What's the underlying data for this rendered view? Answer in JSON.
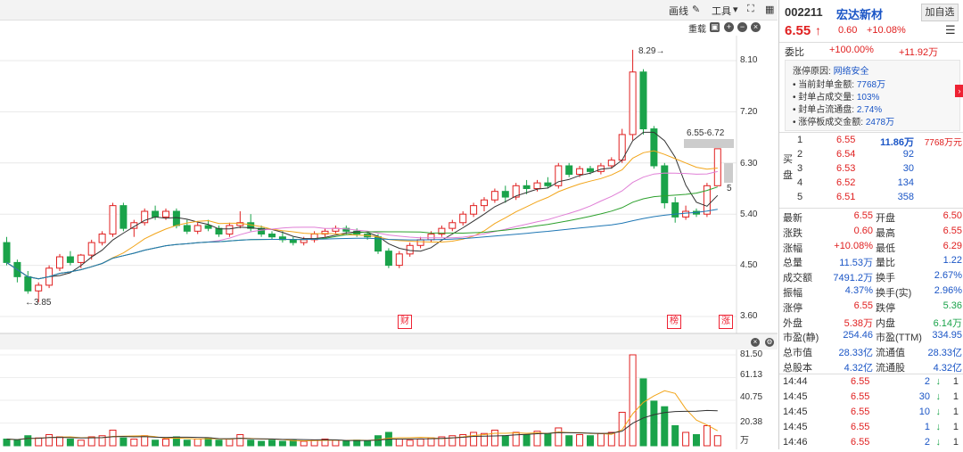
{
  "toolbar": {
    "draw_label": "画线",
    "tools_label": "工具",
    "reset_label": "重载"
  },
  "chart": {
    "y_ticks": [
      "8.10",
      "7.20",
      "6.30",
      "5.40",
      "4.50",
      "3.60"
    ],
    "vol_ticks": [
      "81.50",
      "61.13",
      "40.75",
      "20.38",
      "万"
    ],
    "high_annot": "8.29→",
    "low_annot": "←3.85",
    "range_annot": "6.55-6.72",
    "five_annot": "5",
    "markers": [
      "财",
      "榜",
      "涨"
    ],
    "candles": [
      {
        "o": 4.9,
        "h": 5.0,
        "l": 4.5,
        "c": 4.55
      },
      {
        "o": 4.55,
        "h": 4.6,
        "l": 4.2,
        "c": 4.3
      },
      {
        "o": 4.3,
        "h": 4.4,
        "l": 4.0,
        "c": 4.05
      },
      {
        "o": 4.05,
        "h": 4.2,
        "l": 3.85,
        "c": 4.15
      },
      {
        "o": 4.15,
        "h": 4.5,
        "l": 4.1,
        "c": 4.45
      },
      {
        "o": 4.45,
        "h": 4.7,
        "l": 4.4,
        "c": 4.65
      },
      {
        "o": 4.65,
        "h": 4.75,
        "l": 4.5,
        "c": 4.55
      },
      {
        "o": 4.55,
        "h": 4.7,
        "l": 4.45,
        "c": 4.68
      },
      {
        "o": 4.68,
        "h": 4.95,
        "l": 4.6,
        "c": 4.9
      },
      {
        "o": 4.9,
        "h": 5.1,
        "l": 4.85,
        "c": 5.05
      },
      {
        "o": 5.05,
        "h": 5.6,
        "l": 5.0,
        "c": 5.55
      },
      {
        "o": 5.55,
        "h": 5.6,
        "l": 5.1,
        "c": 5.15
      },
      {
        "o": 5.15,
        "h": 5.3,
        "l": 5.0,
        "c": 5.25
      },
      {
        "o": 5.25,
        "h": 5.5,
        "l": 5.2,
        "c": 5.45
      },
      {
        "o": 5.45,
        "h": 5.55,
        "l": 5.3,
        "c": 5.35
      },
      {
        "o": 5.35,
        "h": 5.5,
        "l": 5.3,
        "c": 5.45
      },
      {
        "o": 5.45,
        "h": 5.5,
        "l": 5.15,
        "c": 5.2
      },
      {
        "o": 5.2,
        "h": 5.3,
        "l": 5.05,
        "c": 5.1
      },
      {
        "o": 5.1,
        "h": 5.25,
        "l": 5.05,
        "c": 5.2
      },
      {
        "o": 5.2,
        "h": 5.3,
        "l": 5.1,
        "c": 5.15
      },
      {
        "o": 5.15,
        "h": 5.2,
        "l": 5.0,
        "c": 5.05
      },
      {
        "o": 5.05,
        "h": 5.25,
        "l": 5.0,
        "c": 5.2
      },
      {
        "o": 5.2,
        "h": 5.45,
        "l": 5.15,
        "c": 5.25
      },
      {
        "o": 5.25,
        "h": 5.4,
        "l": 5.1,
        "c": 5.15
      },
      {
        "o": 5.15,
        "h": 5.2,
        "l": 5.0,
        "c": 5.05
      },
      {
        "o": 5.05,
        "h": 5.1,
        "l": 4.95,
        "c": 5.0
      },
      {
        "o": 5.0,
        "h": 5.1,
        "l": 4.9,
        "c": 4.95
      },
      {
        "o": 4.95,
        "h": 5.0,
        "l": 4.85,
        "c": 4.9
      },
      {
        "o": 4.9,
        "h": 5.0,
        "l": 4.85,
        "c": 4.95
      },
      {
        "o": 4.95,
        "h": 5.1,
        "l": 4.9,
        "c": 5.05
      },
      {
        "o": 5.05,
        "h": 5.15,
        "l": 5.0,
        "c": 5.1
      },
      {
        "o": 5.1,
        "h": 5.2,
        "l": 5.05,
        "c": 5.15
      },
      {
        "o": 5.15,
        "h": 5.2,
        "l": 5.05,
        "c": 5.1
      },
      {
        "o": 5.1,
        "h": 5.15,
        "l": 5.0,
        "c": 5.05
      },
      {
        "o": 5.05,
        "h": 5.1,
        "l": 4.95,
        "c": 5.0
      },
      {
        "o": 5.0,
        "h": 5.05,
        "l": 4.7,
        "c": 4.75
      },
      {
        "o": 4.75,
        "h": 4.8,
        "l": 4.45,
        "c": 4.5
      },
      {
        "o": 4.5,
        "h": 4.75,
        "l": 4.45,
        "c": 4.7
      },
      {
        "o": 4.7,
        "h": 4.9,
        "l": 4.65,
        "c": 4.85
      },
      {
        "o": 4.85,
        "h": 5.0,
        "l": 4.8,
        "c": 4.95
      },
      {
        "o": 4.95,
        "h": 5.1,
        "l": 4.9,
        "c": 5.05
      },
      {
        "o": 5.05,
        "h": 5.2,
        "l": 5.0,
        "c": 5.15
      },
      {
        "o": 5.15,
        "h": 5.3,
        "l": 5.1,
        "c": 5.25
      },
      {
        "o": 5.25,
        "h": 5.45,
        "l": 5.2,
        "c": 5.4
      },
      {
        "o": 5.4,
        "h": 5.6,
        "l": 5.35,
        "c": 5.55
      },
      {
        "o": 5.55,
        "h": 5.7,
        "l": 5.45,
        "c": 5.65
      },
      {
        "o": 5.65,
        "h": 5.85,
        "l": 5.6,
        "c": 5.8
      },
      {
        "o": 5.8,
        "h": 5.9,
        "l": 5.6,
        "c": 5.7
      },
      {
        "o": 5.7,
        "h": 5.95,
        "l": 5.65,
        "c": 5.9
      },
      {
        "o": 5.9,
        "h": 6.0,
        "l": 5.75,
        "c": 5.85
      },
      {
        "o": 5.85,
        "h": 6.0,
        "l": 5.8,
        "c": 5.95
      },
      {
        "o": 5.95,
        "h": 6.05,
        "l": 5.85,
        "c": 5.9
      },
      {
        "o": 5.9,
        "h": 6.3,
        "l": 5.85,
        "c": 6.25
      },
      {
        "o": 6.25,
        "h": 6.3,
        "l": 6.05,
        "c": 6.1
      },
      {
        "o": 6.1,
        "h": 6.25,
        "l": 6.05,
        "c": 6.2
      },
      {
        "o": 6.2,
        "h": 6.25,
        "l": 6.1,
        "c": 6.15
      },
      {
        "o": 6.15,
        "h": 6.3,
        "l": 6.1,
        "c": 6.25
      },
      {
        "o": 6.25,
        "h": 6.4,
        "l": 6.2,
        "c": 6.35
      },
      {
        "o": 6.35,
        "h": 6.9,
        "l": 6.3,
        "c": 6.8
      },
      {
        "o": 6.8,
        "h": 8.29,
        "l": 6.7,
        "c": 7.9
      },
      {
        "o": 7.9,
        "h": 7.95,
        "l": 6.8,
        "c": 6.9
      },
      {
        "o": 6.9,
        "h": 6.95,
        "l": 6.2,
        "c": 6.25
      },
      {
        "o": 6.25,
        "h": 6.3,
        "l": 5.5,
        "c": 5.6
      },
      {
        "o": 5.6,
        "h": 5.7,
        "l": 5.25,
        "c": 5.35
      },
      {
        "o": 5.35,
        "h": 5.55,
        "l": 5.3,
        "c": 5.45
      },
      {
        "o": 5.45,
        "h": 5.5,
        "l": 5.35,
        "c": 5.4
      },
      {
        "o": 5.4,
        "h": 5.95,
        "l": 5.35,
        "c": 5.9
      },
      {
        "o": 5.9,
        "h": 6.55,
        "l": 5.9,
        "c": 6.55
      }
    ],
    "volumes": [
      6,
      5,
      9,
      7,
      10,
      8,
      6,
      5,
      8,
      9,
      14,
      7,
      6,
      9,
      5,
      6,
      8,
      5,
      6,
      7,
      5,
      6,
      10,
      5,
      4,
      5,
      4,
      5,
      4,
      5,
      6,
      5,
      4,
      5,
      4,
      9,
      12,
      6,
      5,
      6,
      7,
      8,
      9,
      10,
      12,
      11,
      14,
      9,
      12,
      10,
      13,
      11,
      16,
      9,
      10,
      9,
      11,
      12,
      30,
      81.5,
      60,
      40,
      35,
      18,
      12,
      10,
      18,
      9
    ]
  },
  "quote": {
    "code": "002211",
    "name": "宏达新材",
    "add_label": "加自选",
    "price": "6.55",
    "change": "0.60",
    "change_pct": "+10.08%",
    "wb_label": "委比",
    "wb_value": "+100.00%",
    "wb_amount": "+11.92万",
    "limit": {
      "reason_label": "涨停原因:",
      "reason": "网络安全",
      "seal_amt_label": "当前封单金额:",
      "seal_amt": "7768万",
      "seal_vol_label": "封单占成交量:",
      "seal_vol": "103%",
      "seal_float_label": "封单占流通盘:",
      "seal_float": "2.74%",
      "limit_amt_label": "涨停板成交金额:",
      "limit_amt": "2478万"
    },
    "buy_label": "买盘",
    "bids": [
      {
        "lvl": "1",
        "price": "6.55",
        "vol": "11.86万",
        "amt": "7768万元"
      },
      {
        "lvl": "2",
        "price": "6.54",
        "vol": "92",
        "amt": ""
      },
      {
        "lvl": "3",
        "price": "6.53",
        "vol": "30",
        "amt": ""
      },
      {
        "lvl": "4",
        "price": "6.52",
        "vol": "134",
        "amt": ""
      },
      {
        "lvl": "5",
        "price": "6.51",
        "vol": "358",
        "amt": ""
      }
    ],
    "stats": [
      {
        "l1": "最新",
        "v1": "6.55",
        "l2": "开盘",
        "v2": "6.50"
      },
      {
        "l1": "涨跌",
        "v1": "0.60",
        "l2": "最高",
        "v2": "6.55"
      },
      {
        "l1": "涨幅",
        "v1": "+10.08%",
        "l2": "最低",
        "v2": "6.29"
      },
      {
        "l1": "总量",
        "v1": "11.53万",
        "l2": "量比",
        "v2": "1.22"
      },
      {
        "l1": "成交额",
        "v1": "7491.2万",
        "l2": "换手",
        "v2": "2.67%"
      },
      {
        "l1": "振幅",
        "v1": "4.37%",
        "l2": "换手(实)",
        "v2": "2.96%"
      },
      {
        "l1": "涨停",
        "v1": "6.55",
        "l2": "跌停",
        "v2": "5.36"
      },
      {
        "l1": "外盘",
        "v1": "5.38万",
        "l2": "内盘",
        "v2": "6.14万"
      },
      {
        "l1": "市盈(静)",
        "v1": "254.46",
        "l2": "市盈(TTM)",
        "v2": "334.95"
      },
      {
        "l1": "总市值",
        "v1": "28.33亿",
        "l2": "流通值",
        "v2": "28.33亿"
      },
      {
        "l1": "总股本",
        "v1": "4.32亿",
        "l2": "流通股",
        "v2": "4.32亿"
      }
    ],
    "ticks": [
      {
        "time": "14:44",
        "price": "6.55",
        "vol": "2",
        "n": "1"
      },
      {
        "time": "14:45",
        "price": "6.55",
        "vol": "30",
        "n": "1"
      },
      {
        "time": "14:45",
        "price": "6.55",
        "vol": "10",
        "n": "1"
      },
      {
        "time": "14:45",
        "price": "6.55",
        "vol": "1",
        "n": "1"
      },
      {
        "time": "14:46",
        "price": "6.55",
        "vol": "2",
        "n": "1"
      }
    ]
  }
}
